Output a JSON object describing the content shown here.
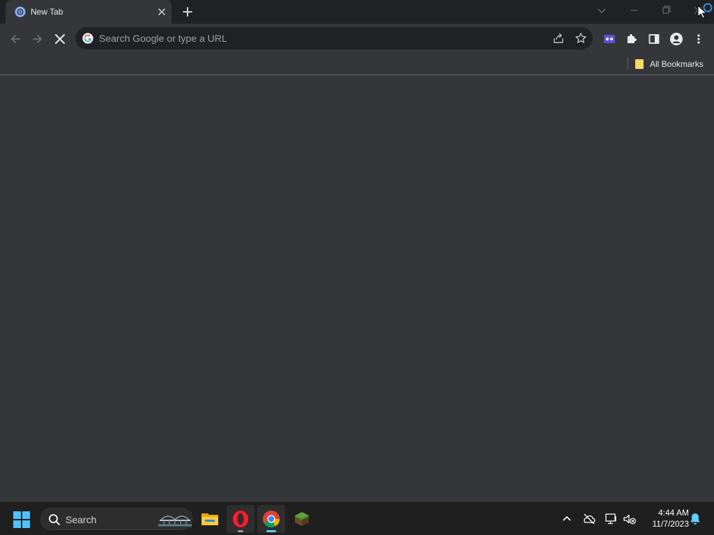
{
  "tab": {
    "title": "New Tab"
  },
  "omnibox": {
    "placeholder": "Search Google or type a URL"
  },
  "bookmarks": {
    "all_bookmarks": "All Bookmarks"
  },
  "taskbar": {
    "search_label": "Search",
    "time": "4:44 AM",
    "date": "11/7/2023",
    "apps": [
      "file-explorer",
      "opera",
      "chrome",
      "minecraft"
    ]
  },
  "colors": {
    "frame": "#202124",
    "toolbar": "#35363a",
    "taskbar": "#1f1f1f",
    "accent": "#60cdff"
  }
}
